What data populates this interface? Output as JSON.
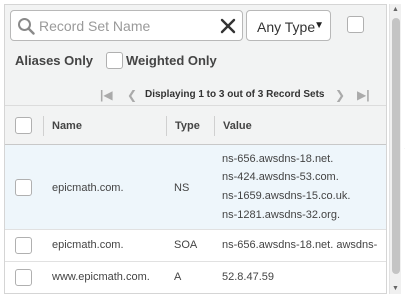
{
  "filter": {
    "search_placeholder": "Record Set Name",
    "type_select": "Any Type",
    "aliases_only_label": "Aliases Only",
    "weighted_only_label": "Weighted Only"
  },
  "pager": {
    "text": "Displaying 1 to 3 out of 3 Record Sets"
  },
  "table": {
    "columns": [
      "Name",
      "Type",
      "Value"
    ],
    "rows": [
      {
        "name": "epicmath.com.",
        "type": "NS",
        "values": [
          "ns-656.awsdns-18.net.",
          "ns-424.awsdns-53.com.",
          "ns-1659.awsdns-15.co.uk.",
          "ns-1281.awsdns-32.org."
        ],
        "selected": true
      },
      {
        "name": "epicmath.com.",
        "type": "SOA",
        "values": [
          "ns-656.awsdns-18.net. awsdns-"
        ],
        "selected": false
      },
      {
        "name": "www.epicmath.com.",
        "type": "A",
        "values": [
          "52.8.47.59"
        ],
        "selected": false
      }
    ]
  }
}
